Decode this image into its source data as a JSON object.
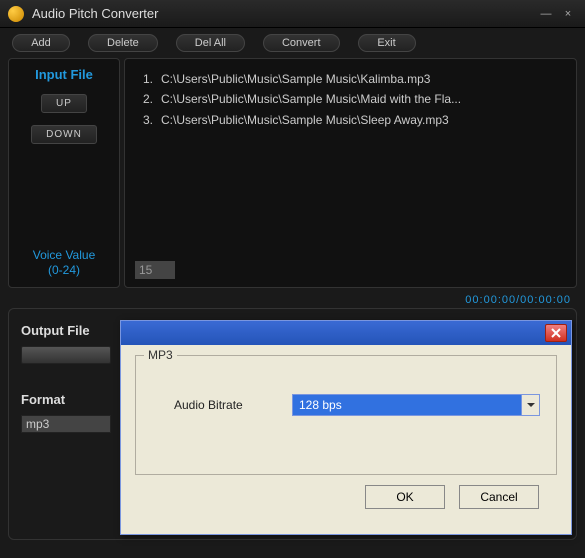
{
  "titlebar": {
    "title": "Audio Pitch Converter"
  },
  "toolbar": {
    "add": "Add",
    "delete": "Delete",
    "delall": "Del All",
    "convert": "Convert",
    "exit": "Exit"
  },
  "left": {
    "title": "Input File",
    "up": "UP",
    "down": "DOWN",
    "voice_label_l1": "Voice Value",
    "voice_label_l2": "(0-24)",
    "voice_value": "15"
  },
  "files": [
    {
      "n": "1.",
      "path": "C:\\Users\\Public\\Music\\Sample Music\\Kalimba.mp3"
    },
    {
      "n": "2.",
      "path": "C:\\Users\\Public\\Music\\Sample Music\\Maid with the Fla..."
    },
    {
      "n": "3.",
      "path": "C:\\Users\\Public\\Music\\Sample Music\\Sleep Away.mp3"
    }
  ],
  "timecode": "00:00:00/00:00:00",
  "output": {
    "label": "Output File"
  },
  "format": {
    "label": "Format",
    "value": "mp3"
  },
  "dialog": {
    "legend": "MP3",
    "bitrate_label": "Audio Bitrate",
    "bitrate_value": "128 bps",
    "ok": "OK",
    "cancel": "Cancel"
  }
}
